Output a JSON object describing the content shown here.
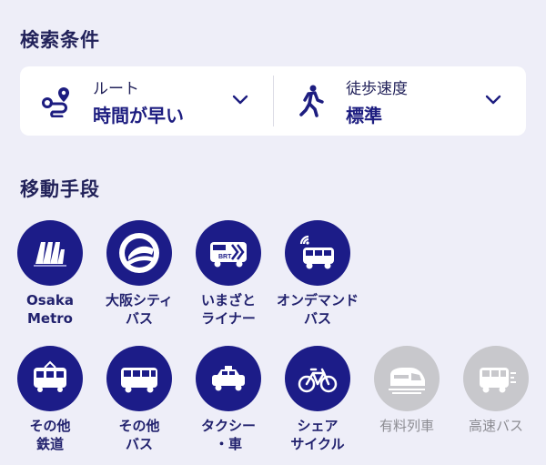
{
  "search_conditions": {
    "title": "検索条件",
    "route": {
      "label": "ルート",
      "value": "時間が早い"
    },
    "walk_speed": {
      "label": "徒歩速度",
      "value": "標準"
    }
  },
  "transport_modes": {
    "title": "移動手段",
    "items": [
      {
        "label": "Osaka\nMetro",
        "icon": "osaka-metro-logo-icon",
        "enabled": true
      },
      {
        "label": "大阪シティ\nバス",
        "icon": "city-bus-logo-icon",
        "enabled": true
      },
      {
        "label": "いまざと\nライナー",
        "icon": "brt-bus-icon",
        "enabled": true
      },
      {
        "label": "オンデマンド\nバス",
        "icon": "on-demand-bus-icon",
        "enabled": true
      },
      {
        "label": "その他\n鉄道",
        "icon": "train-icon",
        "enabled": true
      },
      {
        "label": "その他\nバス",
        "icon": "bus-icon",
        "enabled": true
      },
      {
        "label": "タクシー\n・車",
        "icon": "taxi-icon",
        "enabled": true
      },
      {
        "label": "シェア\nサイクル",
        "icon": "bicycle-icon",
        "enabled": true
      },
      {
        "label": "有料列車",
        "icon": "express-train-icon",
        "enabled": false
      },
      {
        "label": "高速バス",
        "icon": "highway-bus-icon",
        "enabled": false
      }
    ]
  },
  "colors": {
    "background": "#eeeef8",
    "accent": "#1c1c88",
    "disabled": "#c8c8cc",
    "card": "#ffffff"
  }
}
